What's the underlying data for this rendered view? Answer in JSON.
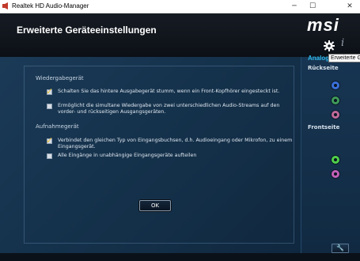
{
  "window": {
    "title": "Realtek HD Audio-Manager",
    "minimize": "─",
    "maximize": "☐",
    "close": "✕"
  },
  "header": {
    "title": "Erweiterte Geräteeinstellungen",
    "logo": "msi",
    "tooltip": "Erweiterte Geräteeinstellungen"
  },
  "playback": {
    "heading": "Wiedergabegerät",
    "options": [
      {
        "text": "Schalten Sie das hintere Ausgabegerät stumm, wenn ein Front-Kopfhörer eingesteckt ist.",
        "checked": true
      },
      {
        "text": "Ermöglicht die simultane Wiedergabe von zwei unterschiedlichen Audio-Streams auf den vorder- und rückseitigen Ausgangsgeräten.",
        "checked": false
      }
    ]
  },
  "recording": {
    "heading": "Aufnahmegerät",
    "options": [
      {
        "text": "Verbindet den gleichen Typ von Eingangsbuchsen, d.h. Audioeingang oder Mikrofon, zu einem Eingangsgerät.",
        "checked": true
      },
      {
        "text": "Alle Eingänge in unabhängige Eingangsgeräte aufteilen",
        "checked": false
      }
    ]
  },
  "ok_label": "OK",
  "sidebar": {
    "analog_label": "Analog",
    "rear_label": "Rückseite",
    "front_label": "Frontseite",
    "rear_jacks": [
      {
        "name": "blue-jack",
        "color": "#3a6fd8"
      },
      {
        "name": "green-jack",
        "color": "#3f9a5a"
      },
      {
        "name": "pink-jack",
        "color": "#c06a9a"
      }
    ],
    "front_jacks": [
      {
        "name": "green-jack",
        "color": "#4fd04a"
      },
      {
        "name": "pink-jack",
        "color": "#c060b8"
      }
    ]
  },
  "colors": {
    "accent": "#2fb6e6",
    "checkmark": "#e6c23a"
  }
}
